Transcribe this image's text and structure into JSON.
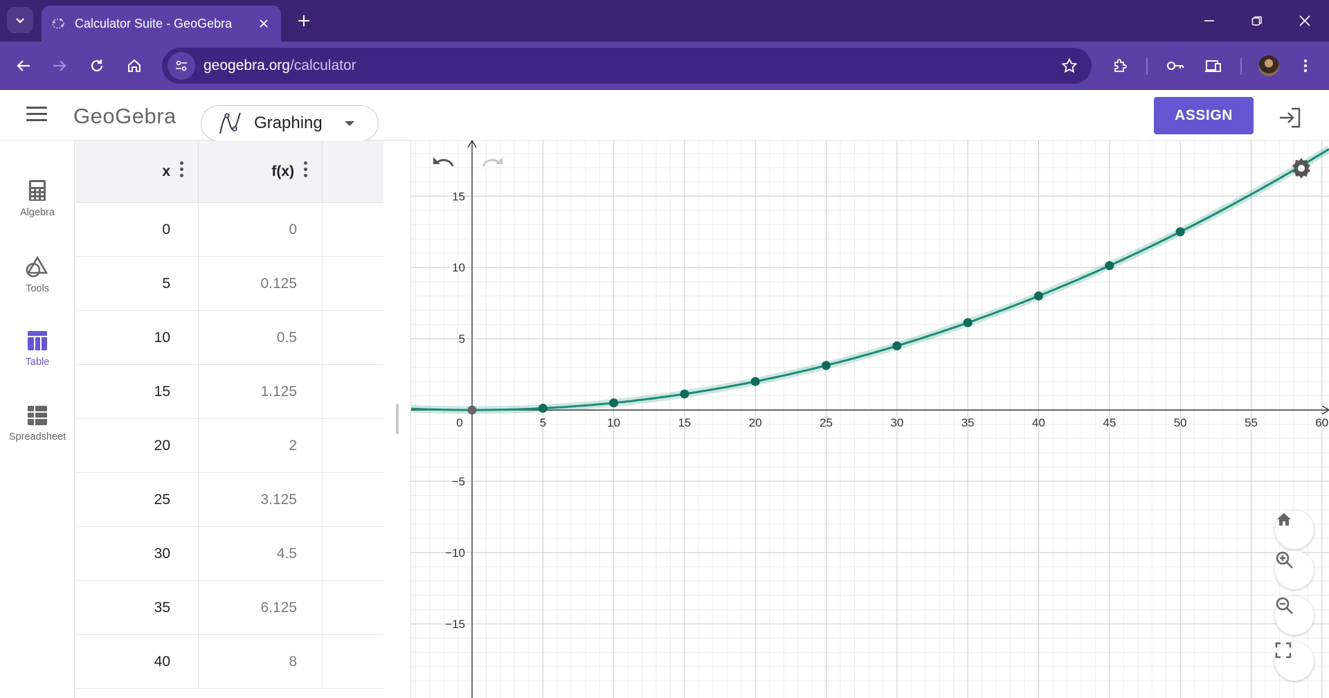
{
  "browser": {
    "tab_title": "Calculator Suite - GeoGebra",
    "url_domain": "geogebra.org",
    "url_path": "/calculator"
  },
  "header": {
    "logo": "GeoGebra",
    "app_name": "Graphing",
    "assign_label": "ASSIGN"
  },
  "rail": {
    "items": [
      {
        "label": "Algebra",
        "icon": "calculator-icon",
        "active": false
      },
      {
        "label": "Tools",
        "icon": "tools-shapes-icon",
        "active": false
      },
      {
        "label": "Table",
        "icon": "table-icon",
        "active": true
      },
      {
        "label": "Spreadsheet",
        "icon": "spreadsheet-icon",
        "active": false
      }
    ]
  },
  "table": {
    "col_x": "x",
    "col_fx": "f(x)",
    "rows": [
      {
        "x": "0",
        "fx": "0"
      },
      {
        "x": "5",
        "fx": "0.125"
      },
      {
        "x": "10",
        "fx": "0.5"
      },
      {
        "x": "15",
        "fx": "1.125"
      },
      {
        "x": "20",
        "fx": "2"
      },
      {
        "x": "25",
        "fx": "3.125"
      },
      {
        "x": "30",
        "fx": "4.5"
      },
      {
        "x": "35",
        "fx": "6.125"
      },
      {
        "x": "40",
        "fx": "8"
      }
    ]
  },
  "chart_data": {
    "type": "line",
    "function": "f(x)",
    "xlim": [
      -4.3,
      60.5
    ],
    "ylim": [
      -20.2,
      18.9
    ],
    "x_ticks": [
      0,
      5,
      10,
      15,
      20,
      25,
      30,
      35,
      40,
      45,
      50,
      55,
      60
    ],
    "y_ticks": [
      15,
      10,
      5,
      -5,
      -10,
      -15
    ],
    "x_tick_labels": [
      "0",
      "5",
      "10",
      "15",
      "20",
      "25",
      "30",
      "35",
      "40",
      "45",
      "50",
      "55",
      "60"
    ],
    "y_tick_labels": [
      "15",
      "10",
      "5",
      "−5",
      "−10",
      "−15"
    ],
    "points": [
      {
        "x": 0,
        "y": 0
      },
      {
        "x": 5,
        "y": 0.125
      },
      {
        "x": 10,
        "y": 0.5
      },
      {
        "x": 15,
        "y": 1.125
      },
      {
        "x": 20,
        "y": 2
      },
      {
        "x": 25,
        "y": 3.125
      },
      {
        "x": 30,
        "y": 4.5
      },
      {
        "x": 35,
        "y": 6.125
      },
      {
        "x": 40,
        "y": 8
      },
      {
        "x": 45,
        "y": 10.125
      },
      {
        "x": 50,
        "y": 12.5
      }
    ],
    "curve_color": "#1a8c78",
    "point_color": "#0f6b5a",
    "origin_point_color": "#666666",
    "grid": true
  },
  "colors": {
    "tabstrip": "#3c2472",
    "toolbar": "#5b41a6",
    "accent": "#6557d2"
  }
}
